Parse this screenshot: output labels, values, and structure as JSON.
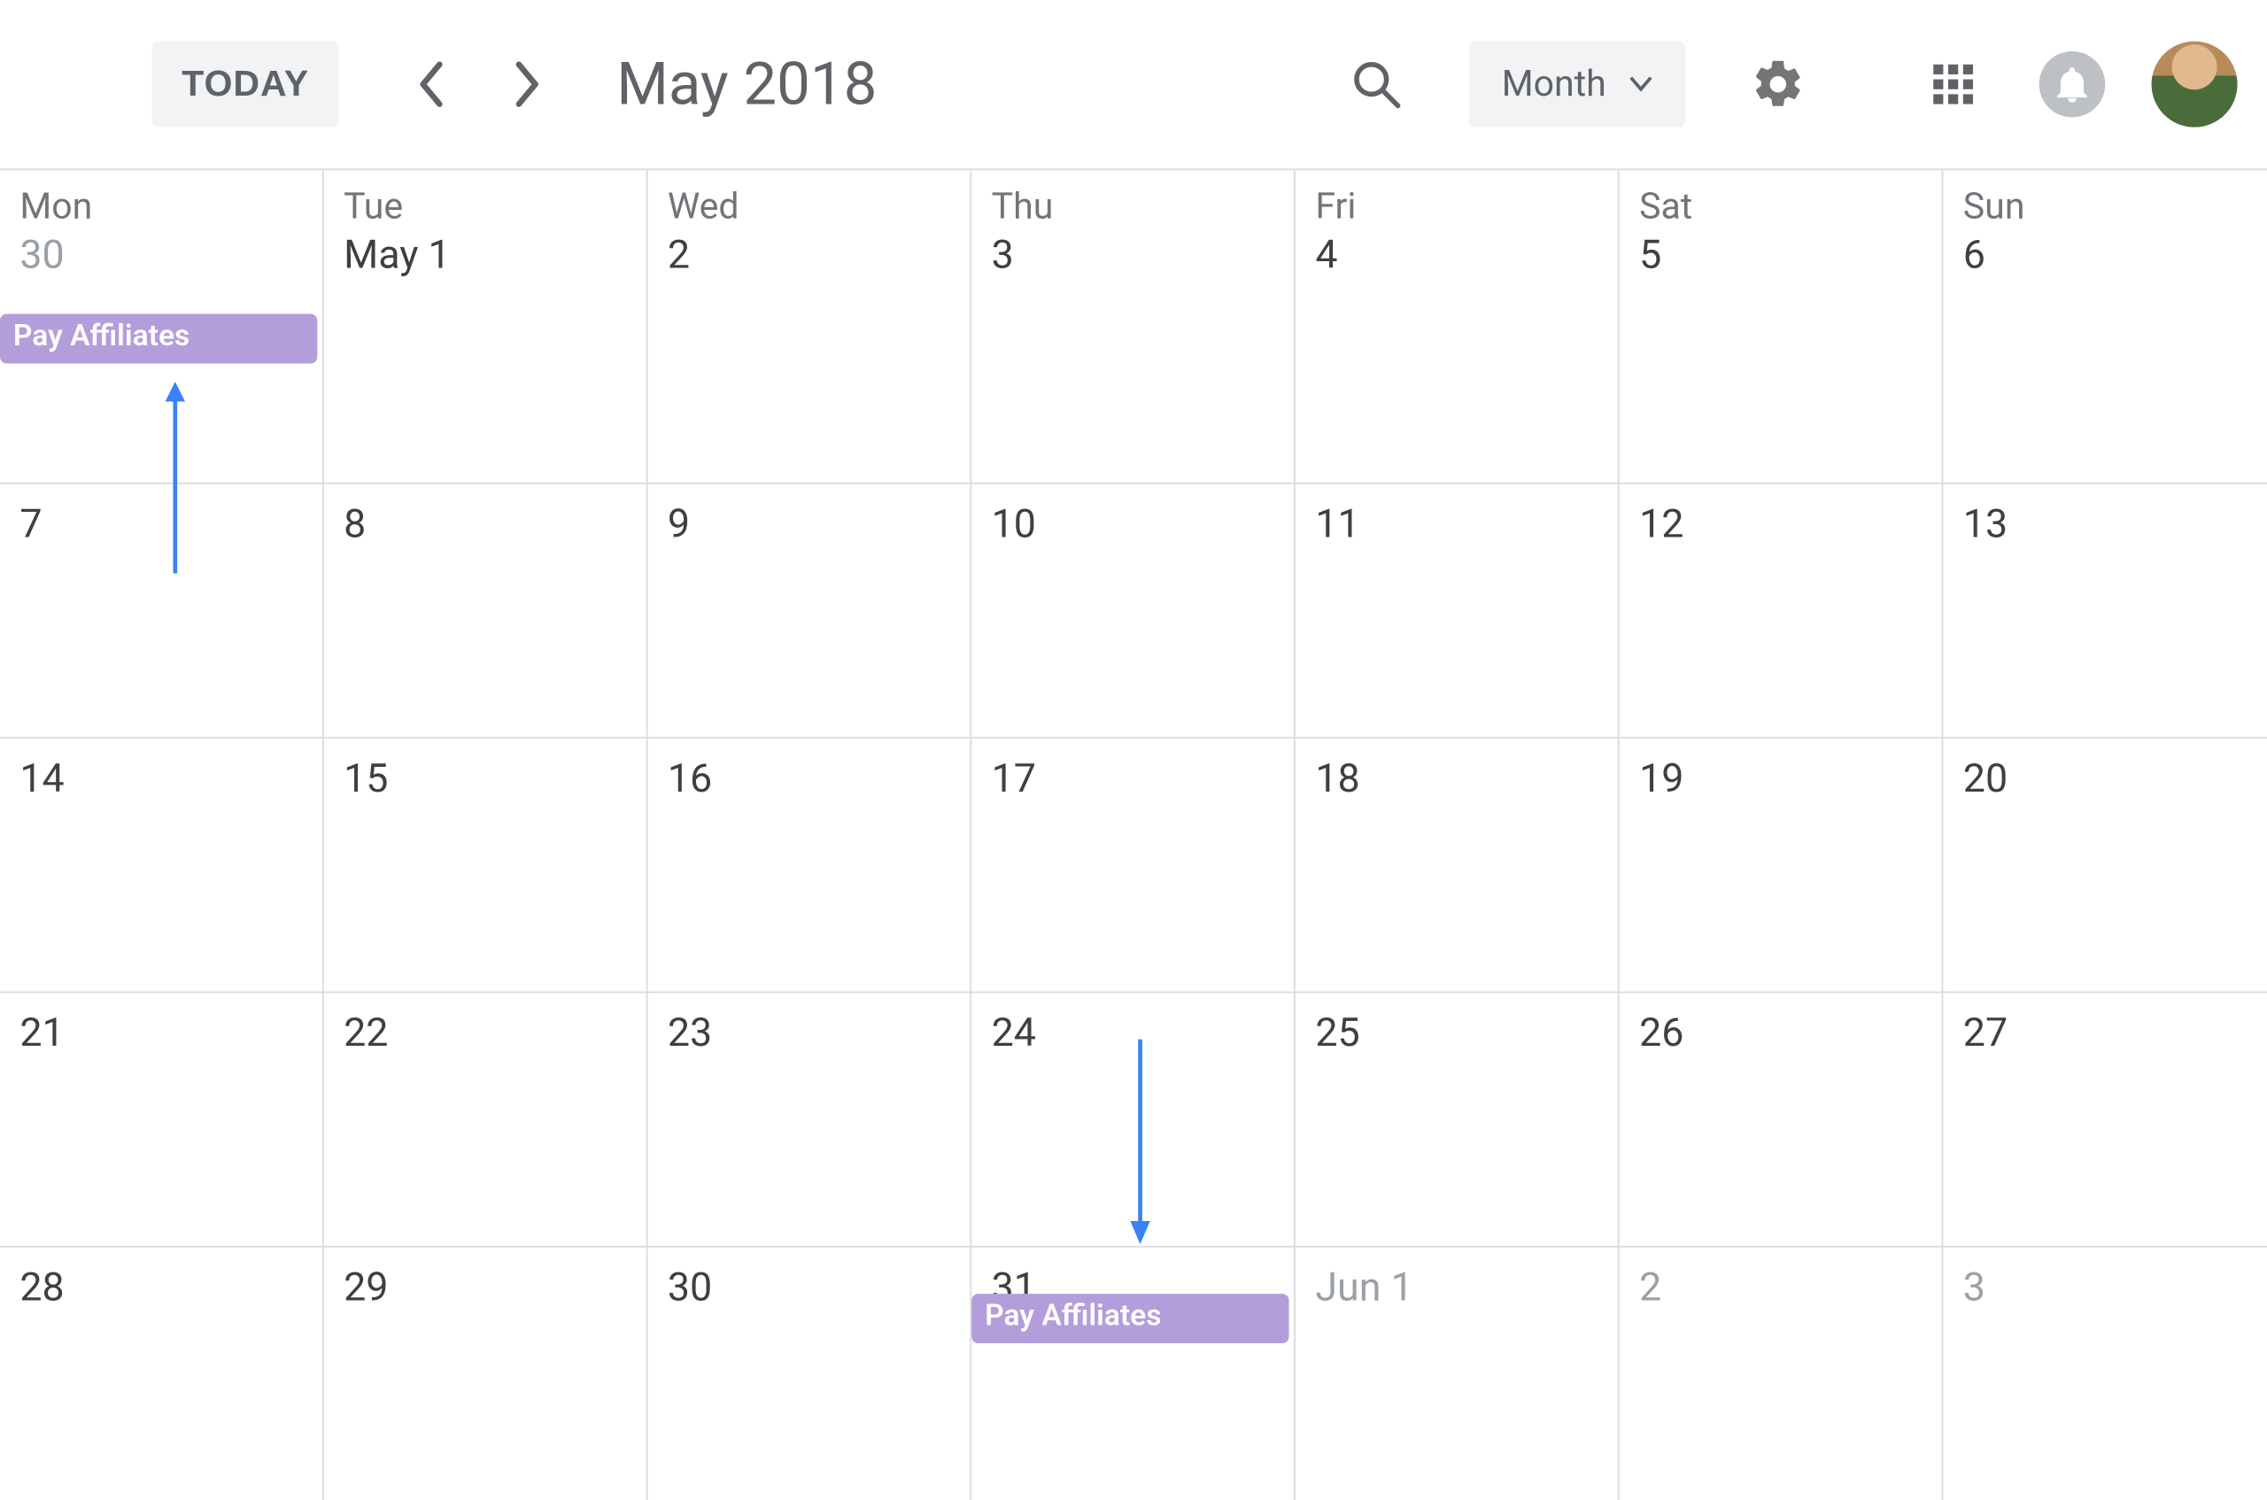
{
  "header": {
    "today_label": "TODAY",
    "month_title": "May 2018",
    "view_select_label": "Month"
  },
  "days_of_week": [
    "Mon",
    "Tue",
    "Wed",
    "Thu",
    "Fri",
    "Sat",
    "Sun"
  ],
  "weeks": [
    [
      {
        "label": "30",
        "muted": true
      },
      {
        "label": "May 1"
      },
      {
        "label": "2"
      },
      {
        "label": "3"
      },
      {
        "label": "4"
      },
      {
        "label": "5"
      },
      {
        "label": "6"
      }
    ],
    [
      {
        "label": "7"
      },
      {
        "label": "8"
      },
      {
        "label": "9"
      },
      {
        "label": "10"
      },
      {
        "label": "11"
      },
      {
        "label": "12"
      },
      {
        "label": "13"
      }
    ],
    [
      {
        "label": "14"
      },
      {
        "label": "15"
      },
      {
        "label": "16"
      },
      {
        "label": "17"
      },
      {
        "label": "18"
      },
      {
        "label": "19"
      },
      {
        "label": "20"
      }
    ],
    [
      {
        "label": "21"
      },
      {
        "label": "22"
      },
      {
        "label": "23"
      },
      {
        "label": "24"
      },
      {
        "label": "25"
      },
      {
        "label": "26"
      },
      {
        "label": "27"
      }
    ],
    [
      {
        "label": "28"
      },
      {
        "label": "29"
      },
      {
        "label": "30"
      },
      {
        "label": "31"
      },
      {
        "label": "Jun 1",
        "muted": true
      },
      {
        "label": "2",
        "muted": true
      },
      {
        "label": "3",
        "muted": true
      }
    ]
  ],
  "events": [
    {
      "title": "Pay Affiliates",
      "week": 0,
      "col": 0
    },
    {
      "title": "Pay Affiliates",
      "week": 4,
      "col": 3
    }
  ],
  "colors": {
    "event_bg": "#b39ddb",
    "arrow": "#3b82f6"
  }
}
